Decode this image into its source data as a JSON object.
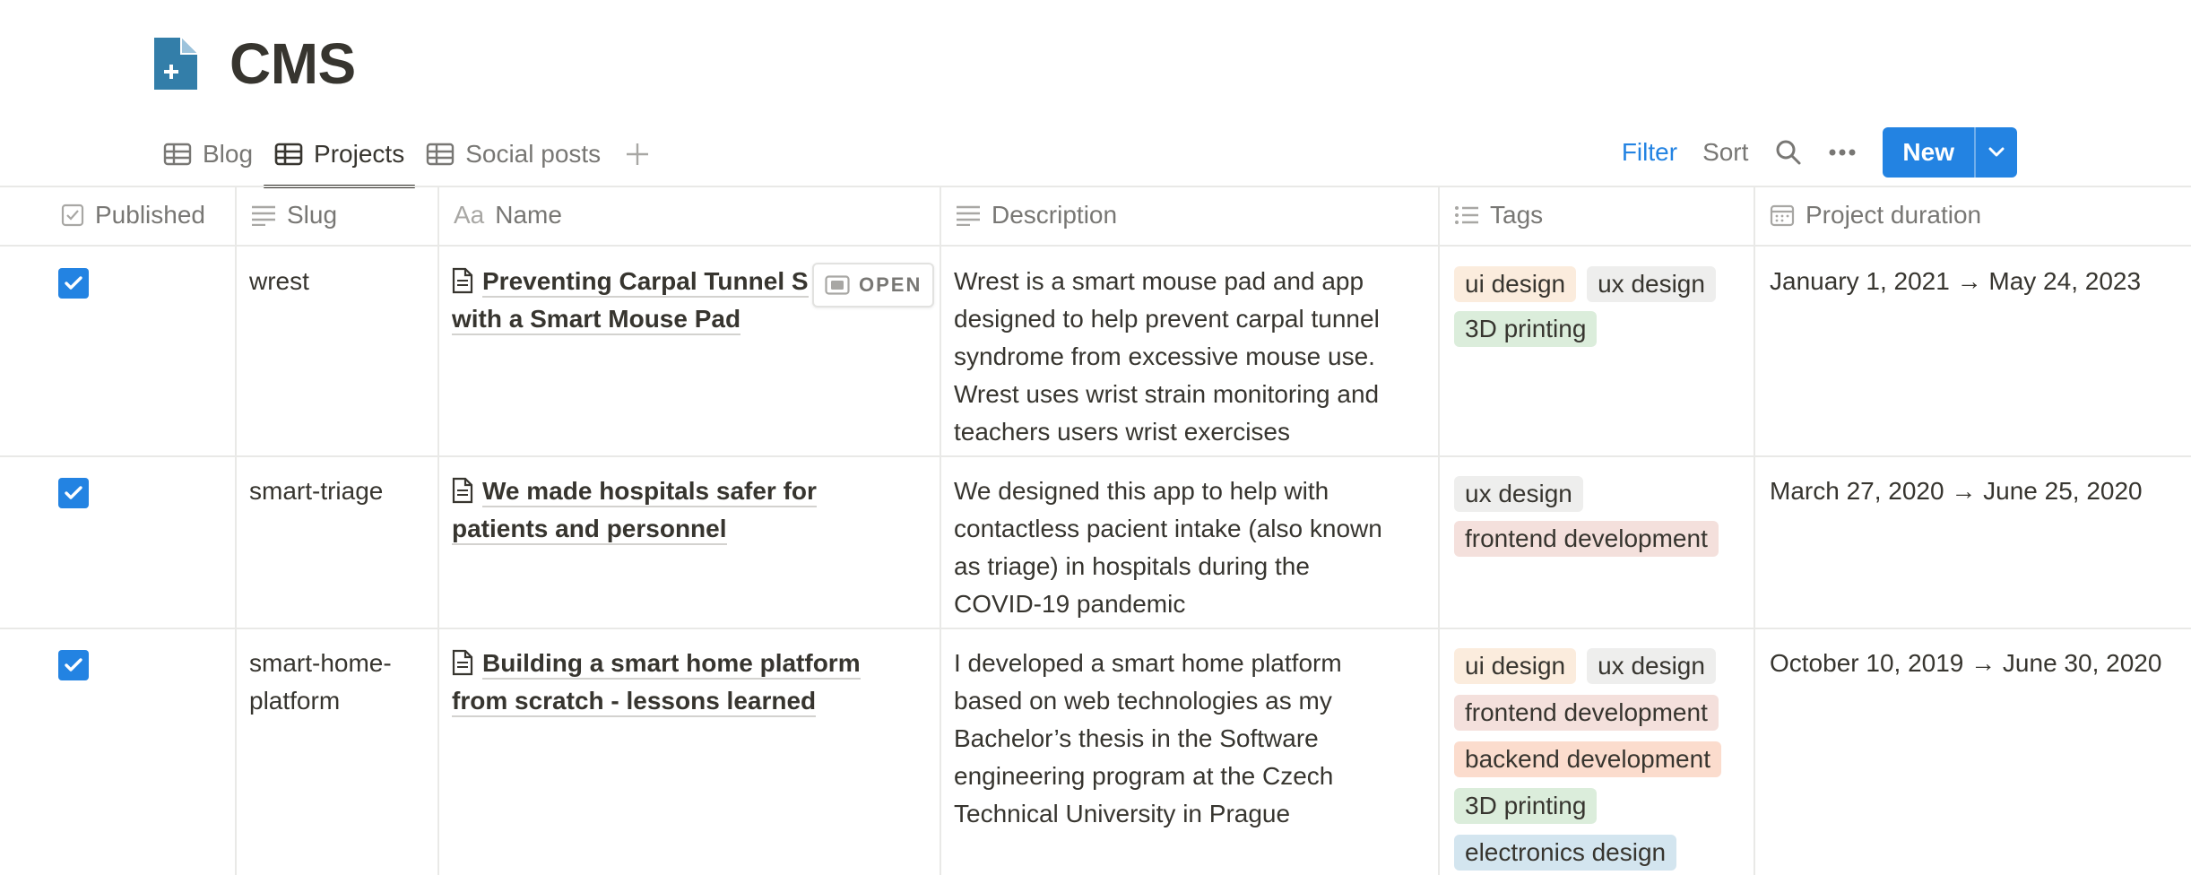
{
  "page": {
    "title": "CMS",
    "icon": "page-plus-icon",
    "accent": "#2383e2"
  },
  "tabs": [
    {
      "label": "Blog",
      "icon": "table-icon",
      "active": false
    },
    {
      "label": "Projects",
      "icon": "table-icon",
      "active": true
    },
    {
      "label": "Social posts",
      "icon": "table-icon",
      "active": false
    }
  ],
  "toolbar": {
    "filter": "Filter",
    "sort": "Sort",
    "new": "New"
  },
  "columns": [
    {
      "label": "Published",
      "icon": "checkbox-icon"
    },
    {
      "label": "Slug",
      "icon": "text-lines-icon"
    },
    {
      "label": "Name",
      "icon": "aa-icon",
      "icon_text": "Aa"
    },
    {
      "label": "Description",
      "icon": "text-lines-icon"
    },
    {
      "label": "Tags",
      "icon": "list-icon"
    },
    {
      "label": "Project duration",
      "icon": "calendar-icon"
    }
  ],
  "open_label": "OPEN",
  "tag_colors": {
    "ui design": "#fbecdd",
    "ux design": "#eeeeed",
    "3D printing": "#dbeddb",
    "frontend development": "#f4e0dc",
    "backend development": "#fbdccd",
    "electronics design": "#d3e5ef"
  },
  "rows": [
    {
      "published": true,
      "slug": "wrest",
      "name_line1": "Preventing Carpal Tunnel S",
      "name_line2": "with a Smart Mouse Pad",
      "description": [
        "Wrest is a smart mouse pad and app",
        "designed to help prevent carpal tunnel",
        "syndrome from excessive mouse use.",
        "Wrest uses wrist strain monitoring and",
        "teachers users wrist exercises"
      ],
      "tags": [
        "ui design",
        "ux design",
        "3D printing"
      ],
      "duration": "January 1, 2021 → May 24, 2023"
    },
    {
      "published": true,
      "slug": "smart-triage",
      "name_line1": "We made hospitals safer for",
      "name_line2": "patients and personnel",
      "description": [
        "We designed this app to help with",
        "contactless pacient intake (also known",
        "as triage) in hospitals during the",
        "COVID-19 pandemic"
      ],
      "tags": [
        "ux design",
        "frontend development"
      ],
      "duration": "March 27, 2020 → June 25, 2020"
    },
    {
      "published": true,
      "slug_line1": "smart-home-",
      "slug_line2": "platform",
      "name_line1": "Building a smart home platform",
      "name_line2": "from scratch - lessons learned",
      "description": [
        "I developed a smart home platform",
        "based on web technologies as my",
        "Bachelor’s thesis in the Software",
        "engineering program at the Czech",
        "Technical University in Prague"
      ],
      "tags": [
        "ui design",
        "ux design",
        "frontend development",
        "backend development",
        "3D printing",
        "electronics design"
      ],
      "duration": "October 10, 2019 → June 30, 2020"
    }
  ]
}
